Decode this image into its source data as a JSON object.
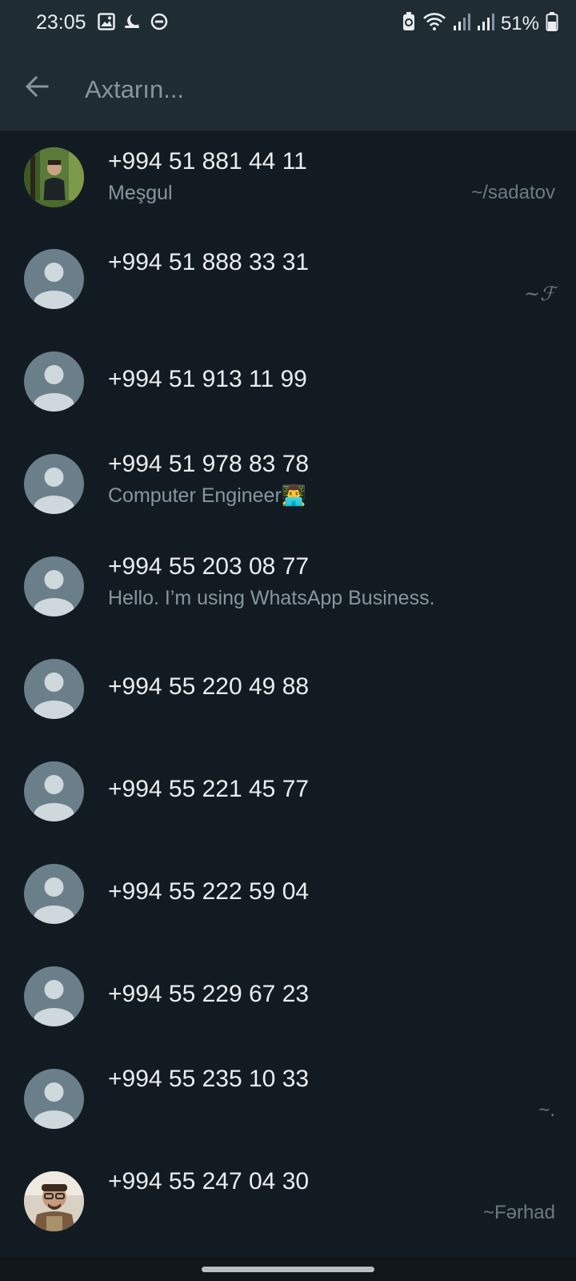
{
  "status_bar": {
    "time": "23:05",
    "battery_percent": "51%",
    "icons": [
      "image-icon",
      "sleep-icon",
      "dnd-icon",
      "battery-saver-icon",
      "wifi-icon",
      "signal-icon",
      "signal-icon",
      "battery-icon"
    ]
  },
  "search": {
    "placeholder": "Axtarın...",
    "value": ""
  },
  "contacts": [
    {
      "name": "+994 51 881 44 11",
      "about": "Meşgul",
      "pushname": "~/sadatov",
      "avatar": "photo"
    },
    {
      "name": "+994 51 888 33 31",
      "about": "",
      "pushname": "~ℱ",
      "avatar": "default"
    },
    {
      "name": "+994 51 913 11 99",
      "about": "",
      "pushname": "",
      "avatar": "default"
    },
    {
      "name": "+994 51 978 83 78",
      "about": "Computer Engineer👨‍💻",
      "pushname": "",
      "avatar": "default"
    },
    {
      "name": "+994 55 203 08 77",
      "about": "Hello. I’m using WhatsApp Business.",
      "pushname": "",
      "avatar": "default"
    },
    {
      "name": "+994 55 220 49 88",
      "about": "",
      "pushname": "",
      "avatar": "default"
    },
    {
      "name": "+994 55 221 45 77",
      "about": "",
      "pushname": "",
      "avatar": "default"
    },
    {
      "name": "+994 55 222 59 04",
      "about": "",
      "pushname": "",
      "avatar": "default"
    },
    {
      "name": "+994 55 229 67 23",
      "about": "",
      "pushname": "",
      "avatar": "default"
    },
    {
      "name": "+994 55 235 10 33",
      "about": "",
      "pushname": "~.",
      "avatar": "default"
    },
    {
      "name": "+994 55 247 04 30",
      "about": "",
      "pushname": "~Fərhad",
      "avatar": "photo"
    }
  ],
  "colors": {
    "background": "#121b22",
    "header": "#1f2c34",
    "primary_text": "#e9edef",
    "secondary_text": "#8696a0",
    "avatar_default": "#6a7f8a"
  }
}
